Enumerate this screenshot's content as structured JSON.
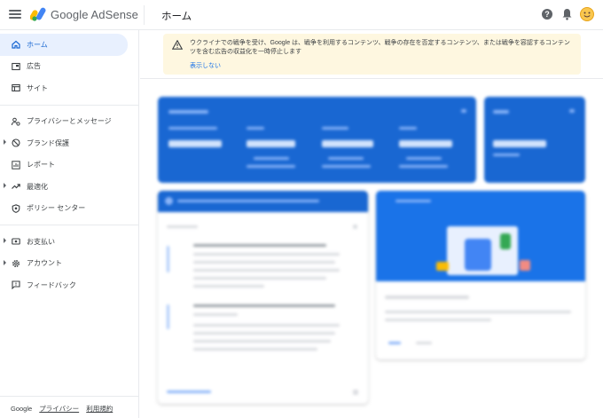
{
  "header": {
    "brand": "Google AdSense",
    "page_title": "ホーム",
    "help_glyph": "?"
  },
  "sidebar": {
    "items": [
      {
        "label": "ホーム",
        "icon": "home-icon"
      },
      {
        "label": "広告",
        "icon": "ads-icon"
      },
      {
        "label": "サイト",
        "icon": "sites-icon"
      },
      {
        "label": "プライバシーとメッセージ",
        "icon": "privacy-icon"
      },
      {
        "label": "ブランド保護",
        "icon": "block-icon"
      },
      {
        "label": "レポート",
        "icon": "reports-icon"
      },
      {
        "label": "最適化",
        "icon": "trending-icon"
      },
      {
        "label": "ポリシー センター",
        "icon": "policy-shield-icon"
      },
      {
        "label": "お支払い",
        "icon": "payments-icon"
      },
      {
        "label": "アカウント",
        "icon": "gear-icon"
      },
      {
        "label": "フィードバック",
        "icon": "feedback-icon"
      }
    ],
    "footer": {
      "google": "Google",
      "privacy": "プライバシー",
      "terms": "利用規約"
    }
  },
  "banner": {
    "text": "ウクライナでの戦争を受け、Google は、戦争を利用するコンテンツ、戦争の存在を否定するコンテンツ、または戦争を容認するコンテンツを含む広告の収益化を一時停止します",
    "link": "表示しない"
  },
  "colors": {
    "accent": "#1967d2",
    "banner_bg": "#fef7e0",
    "active_nav_bg": "#e8f0fe"
  }
}
